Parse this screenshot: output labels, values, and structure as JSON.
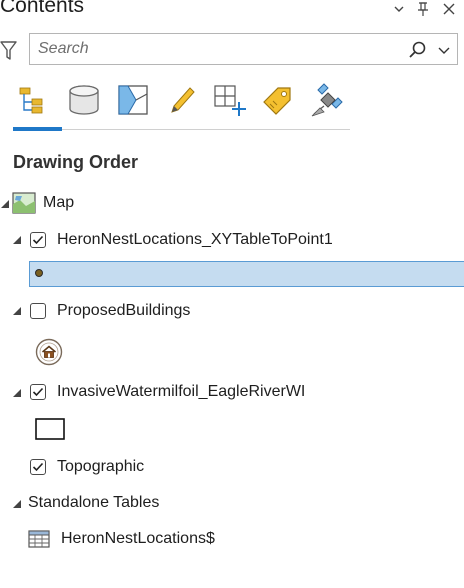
{
  "pane": {
    "title": "Contents",
    "buttons": [
      {
        "name": "options-dropdown",
        "icon": "chevron-down-icon"
      },
      {
        "name": "auto-hide",
        "icon": "pin-icon"
      },
      {
        "name": "close",
        "icon": "close-icon"
      }
    ]
  },
  "search": {
    "placeholder": "Search",
    "value": "",
    "filter_icon": "filter-icon",
    "search_icon": "search-icon",
    "dropdown_icon": "chevron-down-icon"
  },
  "toolbar": {
    "active_index": 0,
    "accent_color": "#1f78c8",
    "items": [
      {
        "name": "list-by-drawing-order",
        "icon": "drawing-order-icon"
      },
      {
        "name": "list-by-data-source",
        "icon": "database-icon"
      },
      {
        "name": "list-by-selection",
        "icon": "selection-icon"
      },
      {
        "name": "list-by-editing",
        "icon": "pencil-icon"
      },
      {
        "name": "list-by-snapping",
        "icon": "snapping-icon"
      },
      {
        "name": "list-by-labeling",
        "icon": "label-tag-icon"
      },
      {
        "name": "list-by-perspective-imagery",
        "icon": "satellite-icon"
      }
    ]
  },
  "section": {
    "title": "Drawing Order"
  },
  "tree": {
    "map": {
      "label": "Map",
      "icon": "map-icon",
      "expanded": true
    },
    "layers": [
      {
        "label": "HeronNestLocations_XYTableToPoint1",
        "checked": true,
        "expanded": true,
        "symbol": "point-symbol",
        "selected": true
      },
      {
        "label": "ProposedBuildings",
        "checked": false,
        "expanded": true,
        "symbol": "house-symbol"
      },
      {
        "label": "InvasiveWatermilfoil_EagleRiverWI",
        "checked": true,
        "expanded": true,
        "symbol": "polygon-symbol"
      },
      {
        "label": "Topographic",
        "checked": true,
        "expanded": false,
        "basemap": true
      }
    ],
    "standalone": {
      "label": "Standalone Tables",
      "expanded": true,
      "items": [
        {
          "label": "HeronNestLocations$",
          "icon": "table-icon"
        }
      ]
    }
  },
  "colors": {
    "selection_fill": "#c5dcf0",
    "selection_border": "#5a9bd4",
    "point_fill": "#7a6020"
  }
}
